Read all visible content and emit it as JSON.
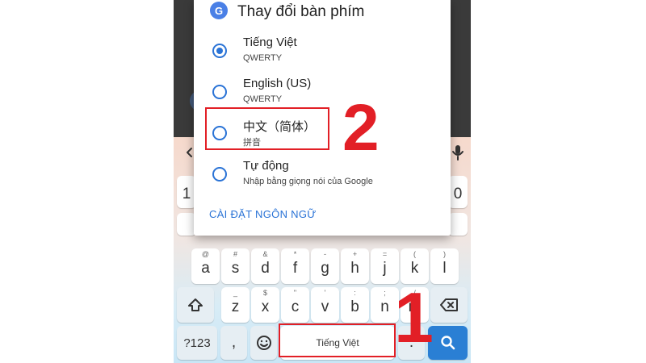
{
  "dialog": {
    "title": "Thay đổi bàn phím",
    "logo_letter": "G",
    "options": [
      {
        "name": "Tiếng Việt",
        "sub": "QWERTY",
        "selected": true
      },
      {
        "name": "English (US)",
        "sub": "QWERTY",
        "selected": false
      },
      {
        "name": "中文（简体）",
        "sub": "拼音",
        "selected": false
      },
      {
        "name": "Tự động",
        "sub": "Nhập bằng giọng nói của Google",
        "selected": false
      }
    ],
    "settings_link": "CÀI ĐẶT NGÔN NGỮ"
  },
  "annotations": {
    "step1": "1",
    "step2": "2",
    "highlight_color": "#e21f26"
  },
  "keyboard": {
    "row_top_partial": [
      "1",
      "0"
    ],
    "row_home": [
      {
        "key": "a",
        "hint": "@"
      },
      {
        "key": "s",
        "hint": "#"
      },
      {
        "key": "d",
        "hint": "&"
      },
      {
        "key": "f",
        "hint": "*"
      },
      {
        "key": "g",
        "hint": "-"
      },
      {
        "key": "h",
        "hint": "+"
      },
      {
        "key": "j",
        "hint": "="
      },
      {
        "key": "k",
        "hint": "("
      },
      {
        "key": "l",
        "hint": ")"
      }
    ],
    "row_bottom": [
      {
        "key": "z",
        "hint": "_"
      },
      {
        "key": "x",
        "hint": "$"
      },
      {
        "key": "c",
        "hint": "\""
      },
      {
        "key": "v",
        "hint": "'"
      },
      {
        "key": "b",
        "hint": ":"
      },
      {
        "key": "n",
        "hint": ";"
      },
      {
        "key": "m",
        "hint": "/"
      }
    ],
    "symbols_label": "?123",
    "comma_label": ",",
    "space_label": "Tiếng Việt",
    "period_label": ".",
    "accent_color": "#2a7fd4"
  }
}
